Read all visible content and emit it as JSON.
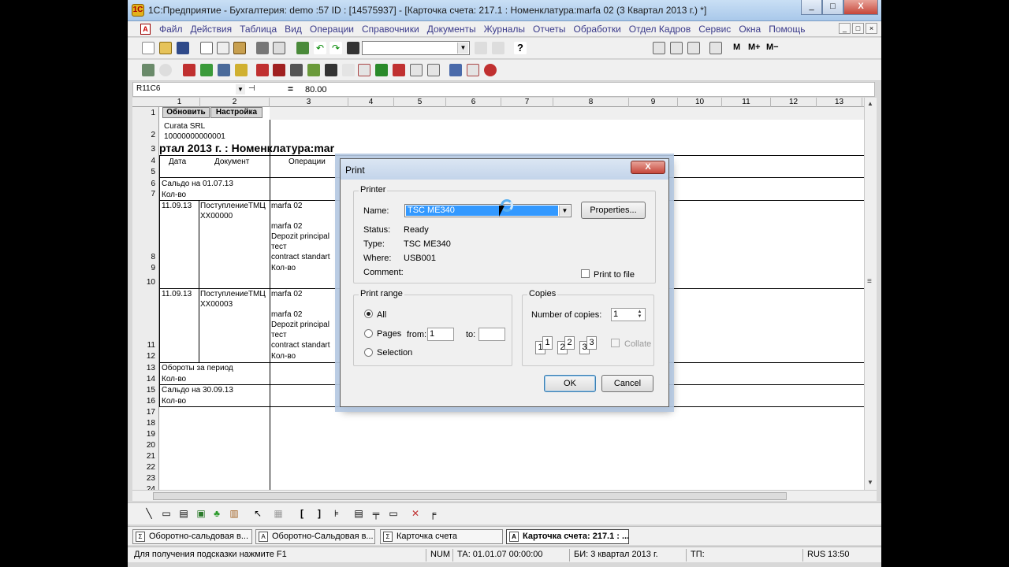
{
  "window": {
    "title": "1С:Предприятие - Бухгалтерия: demo :57 ID : [14575937] - [Карточка счета: 217.1 : Номенклатура:marfa 02 (3 Квартал 2013 г.)  *]",
    "minimize": "_",
    "maximize": "□",
    "close": "X"
  },
  "menu": {
    "items": [
      "Файл",
      "Действия",
      "Таблица",
      "Вид",
      "Операции",
      "Справочники",
      "Документы",
      "Журналы",
      "Отчеты",
      "Обработки",
      "Отдел Кадров",
      "Сервис",
      "Окна",
      "Помощь"
    ]
  },
  "mdi_buttons": [
    "_",
    "□",
    "×"
  ],
  "toolbar": {
    "mode_buttons": [
      "M",
      "M+",
      "M−"
    ]
  },
  "formula_bar": {
    "cell_ref": "R11C6",
    "equals": "=",
    "value": "80.00"
  },
  "sheet": {
    "col_headers": [
      "1",
      "2",
      "3",
      "4",
      "5",
      "6",
      "7",
      "8",
      "9",
      "10",
      "11",
      "12",
      "13"
    ],
    "row_headers": [
      "1",
      "2",
      "3",
      "4",
      "5",
      "6",
      "7",
      "8",
      "9",
      "10",
      "11",
      "12",
      "13",
      "14",
      "15",
      "16",
      "17",
      "18",
      "19",
      "20",
      "21",
      "22",
      "23",
      "24"
    ],
    "btn_refresh": "Обновить",
    "btn_settings": "Настройка",
    "company": "Curata SRL",
    "code": "10000000000001",
    "title": "ртал 2013 г. : Номенклатура:mar",
    "hdr_date": "Дата",
    "hdr_doc": "Документ",
    "hdr_ops": "Операции",
    "opening": "Сальдо на 01.07.13",
    "qty": "Кол-во",
    "entries": [
      {
        "date": "11.09.13",
        "doc1": "ПоступлениеТМЦ",
        "doc2": "XX00000",
        "ops": [
          "marfa 02",
          "",
          "marfa 02",
          "Depozit principal",
          "тест",
          "contract standart",
          "Кол-во"
        ]
      },
      {
        "date": "11.09.13",
        "doc1": "ПоступлениеТМЦ",
        "doc2": "XX00003",
        "ops": [
          "marfa 02",
          "",
          "marfa 02",
          "Depozit principal",
          "тест",
          "contract standart",
          "Кол-во"
        ]
      }
    ],
    "turnover": "Обороты за период",
    "closing": "Сальдо на 30.09.13"
  },
  "print_dialog": {
    "title": "Print",
    "close": "X",
    "printer_group": "Printer",
    "name_label": "Name:",
    "printer_name": "TSC ME340",
    "properties": "Properties...",
    "status_label": "Status:",
    "status": "Ready",
    "type_label": "Type:",
    "type": "TSC ME340",
    "where_label": "Where:",
    "where": "USB001",
    "comment_label": "Comment:",
    "print_to_file": "Print to file",
    "range_group": "Print range",
    "all": "All",
    "pages": "Pages",
    "from": "from:",
    "from_value": "1",
    "to": "to:",
    "to_value": "",
    "selection": "Selection",
    "copies_group": "Copies",
    "num_copies_label": "Number of copies:",
    "num_copies": "1",
    "collate": "Collate",
    "collate_pages": [
      "1",
      "1",
      "2",
      "2",
      "3",
      "3"
    ],
    "ok": "OK",
    "cancel": "Cancel"
  },
  "tasks": [
    {
      "label": "Оборотно-сальдовая в...",
      "active": false
    },
    {
      "label": "Оборотно-Сальдовая в...",
      "active": false
    },
    {
      "label": "Карточка счета",
      "active": false
    },
    {
      "label": "Карточка счета: 217.1 : ...",
      "active": true
    }
  ],
  "status_bar": {
    "hint": "Для получения подсказки нажмите F1",
    "num": "NUM",
    "ta": "ТА: 01.01.07  00:00:00",
    "bi": "БИ: 3 квартал 2013 г.",
    "tp": "ТП:",
    "lang": "RUS",
    "time": "13:50"
  }
}
